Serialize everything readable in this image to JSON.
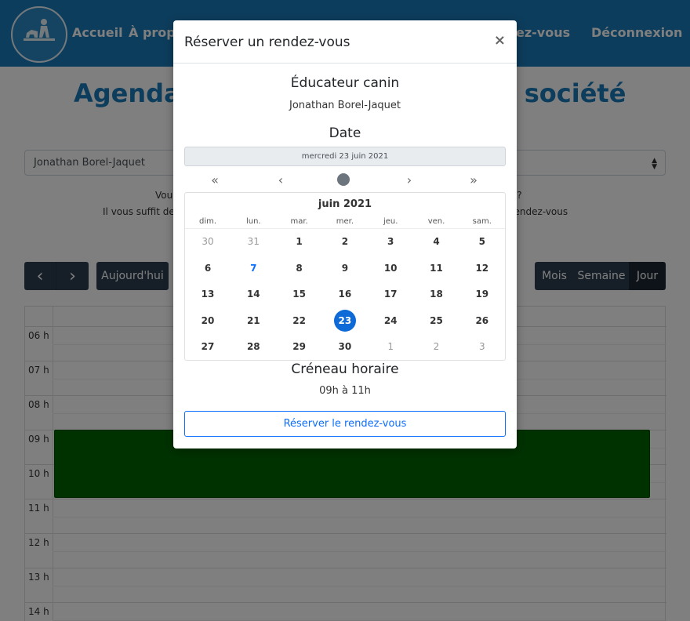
{
  "nav": {
    "accueil": "Accueil",
    "apropos": "À propo",
    "rdv": "ez-vous",
    "deconnexion": "Déconnexion"
  },
  "page": {
    "title_left": "Agenda",
    "title_right": "a société",
    "selected_educator": "Jonathan Borel-Jaquet",
    "info_line1_left": "Vou",
    "info_line1_right": "été ?",
    "info_line2_left": "Il vous suffit de",
    "info_line2_right": "re rendez-vous"
  },
  "calendar_toolbar": {
    "prev": "‹",
    "next": "›",
    "today": "Aujourd'hui",
    "views": [
      "Mois",
      "Semaine",
      "Jour"
    ]
  },
  "agenda_hours": [
    "06 h",
    "07 h",
    "08 h",
    "09 h",
    "10 h",
    "11 h",
    "12 h",
    "13 h",
    "14 h"
  ],
  "modal": {
    "title": "Réserver un rendez-vous",
    "close": "×",
    "educator_title": "Éducateur canin",
    "educator_name": "Jonathan Borel-Jaquet",
    "date_title": "Date",
    "date_value": "mercredi 23 juin 2021",
    "slot_title": "Créneau horaire",
    "slot_value": "09h à 11h",
    "reserve_button": "Réserver le rendez-vous"
  },
  "datepicker": {
    "month_label": "juin 2021",
    "weekdays": [
      "dim.",
      "lun.",
      "mar.",
      "mer.",
      "jeu.",
      "ven.",
      "sam."
    ],
    "weeks": [
      [
        "30",
        "31",
        "1",
        "2",
        "3",
        "4",
        "5"
      ],
      [
        "6",
        "7",
        "8",
        "9",
        "10",
        "11",
        "12"
      ],
      [
        "13",
        "14",
        "15",
        "16",
        "17",
        "18",
        "19"
      ],
      [
        "20",
        "21",
        "22",
        "23",
        "24",
        "25",
        "26"
      ],
      [
        "27",
        "28",
        "29",
        "30",
        "1",
        "2",
        "3"
      ]
    ],
    "muted": [
      [
        0,
        0
      ],
      [
        0,
        1
      ],
      [
        4,
        4
      ],
      [
        4,
        5
      ],
      [
        4,
        6
      ]
    ],
    "today": [
      1,
      1
    ],
    "selected": [
      3,
      3
    ],
    "accent_color": "#0d6ad6"
  }
}
